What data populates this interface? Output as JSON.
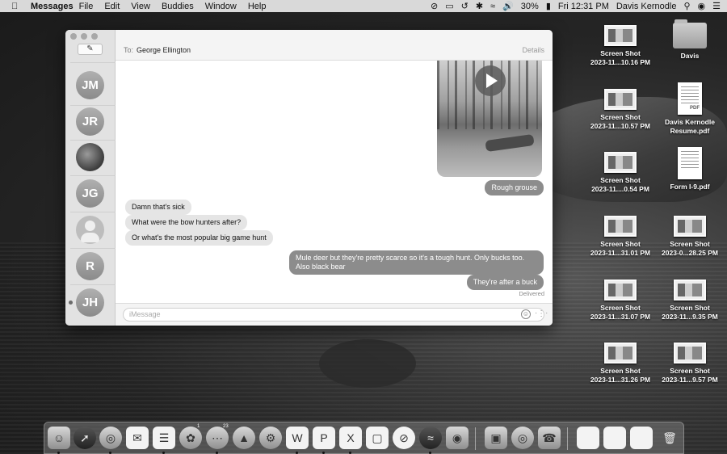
{
  "menubar": {
    "app_name": "Messages",
    "menus": [
      "File",
      "Edit",
      "View",
      "Buddies",
      "Window",
      "Help"
    ],
    "battery": "30%",
    "clock": "Fri 12:31 PM",
    "user": "Davis Kernodle"
  },
  "window": {
    "to_label": "To:",
    "recipient": "George Ellington",
    "details_label": "Details",
    "input_placeholder": "iMessage"
  },
  "sidebar": {
    "contacts": [
      {
        "initials": "JM"
      },
      {
        "initials": "JR"
      },
      {
        "initials": ""
      },
      {
        "initials": "JG"
      },
      {
        "initials": ""
      },
      {
        "initials": "R"
      },
      {
        "initials": "JH"
      }
    ]
  },
  "messages": {
    "m1": "Rough grouse",
    "m2": "Damn that's sick",
    "m3": "What were the bow hunters after?",
    "m4": "Or what's the most popular big game hunt",
    "m5": "Mule deer but they're pretty scarce so it's a tough hunt. Only bucks too. Also black bear",
    "m6": "They're after a buck",
    "status": "Delivered"
  },
  "desktop": {
    "items": [
      {
        "line1": "Screen Shot",
        "line2": "2023-11...10.16 PM"
      },
      {
        "line1": "Davis",
        "line2": ""
      },
      {
        "line1": "Screen Shot",
        "line2": "2023-11...10.57 PM"
      },
      {
        "line1": "Davis Kernodle",
        "line2": "Resume.pdf"
      },
      {
        "line1": "Screen Shot",
        "line2": "2023-11....0.54 PM"
      },
      {
        "line1": "Form I-9.pdf",
        "line2": ""
      },
      {
        "line1": "Screen Shot",
        "line2": "2023-11...31.01 PM"
      },
      {
        "line1": "Screen Shot",
        "line2": "2023-0...28.25 PM"
      },
      {
        "line1": "Screen Shot",
        "line2": "2023-11...31.07 PM"
      },
      {
        "line1": "Screen Shot",
        "line2": "2023-11...9.35 PM"
      },
      {
        "line1": "Screen Shot",
        "line2": "2023-11...31.26 PM"
      },
      {
        "line1": "Screen Shot",
        "line2": "2023-11...9.57 PM"
      }
    ],
    "pdf_tag": "PDF"
  },
  "dock": {
    "messages_badge": "23",
    "photos_badge": "1"
  }
}
